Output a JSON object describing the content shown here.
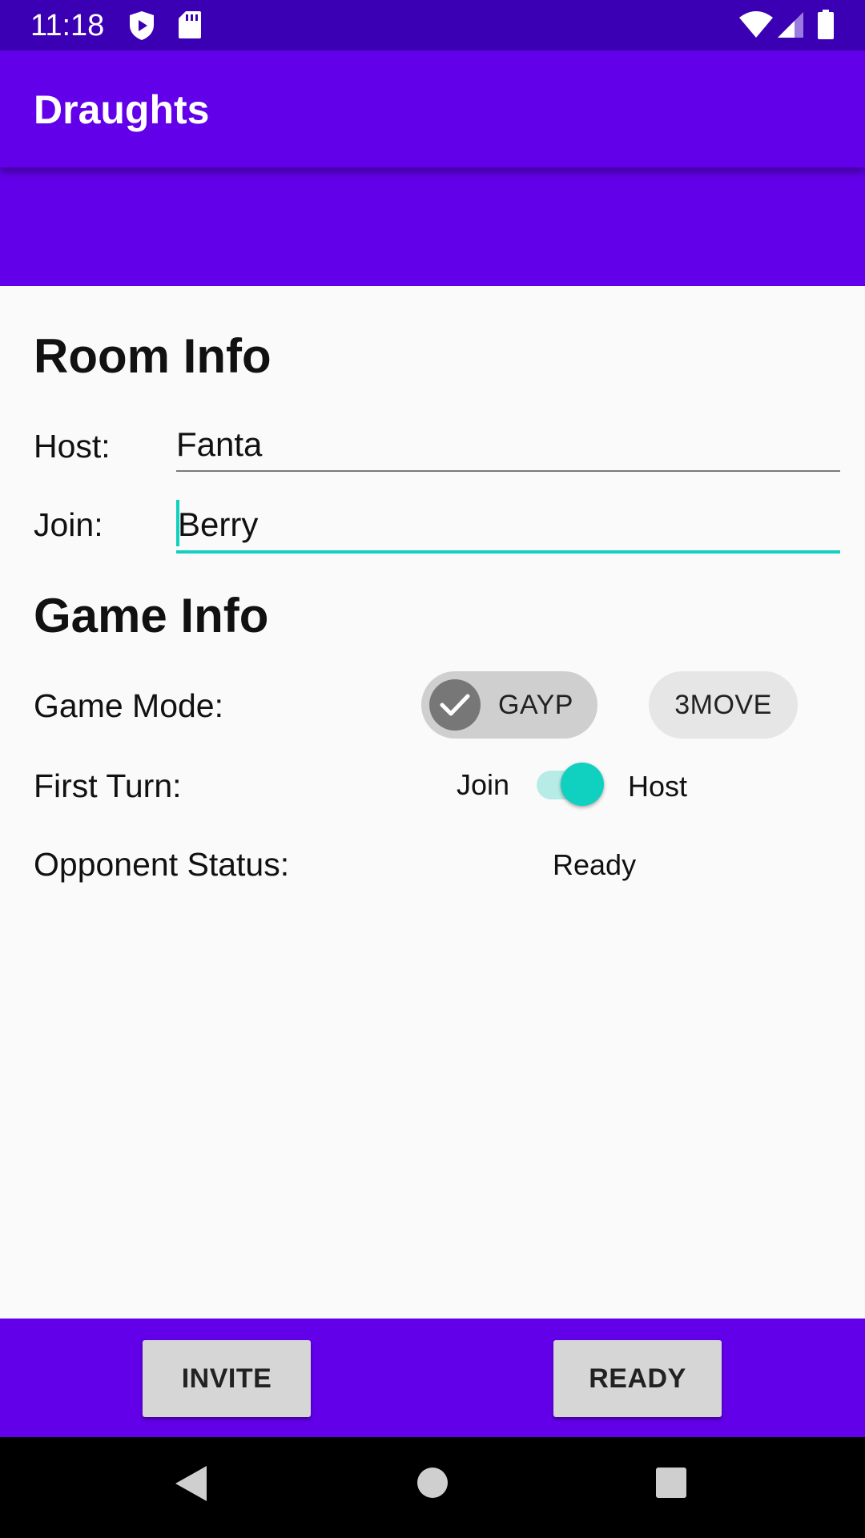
{
  "status_bar": {
    "time": "11:18",
    "icons_left": [
      "shield-play-icon",
      "sd-card-icon"
    ],
    "icons_right": [
      "wifi-icon",
      "signal-icon",
      "battery-icon"
    ]
  },
  "app_bar": {
    "title": "Draughts"
  },
  "room_info": {
    "title": "Room Info",
    "host_label": "Host:",
    "host_value": "Fanta",
    "join_label": "Join:",
    "join_value": "Berry"
  },
  "game_info": {
    "title": "Game Info",
    "game_mode_label": "Game Mode:",
    "game_modes": [
      {
        "label": "GAYP",
        "selected": true
      },
      {
        "label": "3MOVE",
        "selected": false
      }
    ],
    "first_turn_label": "First Turn:",
    "first_turn_off_label": "Join",
    "first_turn_on_label": "Host",
    "first_turn_switch_on": true,
    "opponent_status_label": "Opponent Status:",
    "opponent_status_value": "Ready"
  },
  "actions": {
    "invite_label": "INVITE",
    "ready_label": "READY"
  },
  "nav_bar": {
    "icons": [
      "back-icon",
      "home-icon",
      "recents-icon"
    ]
  },
  "colors": {
    "primary": "#6200ea",
    "primary_dark": "#3b00b3",
    "accent": "#10d0bf"
  }
}
